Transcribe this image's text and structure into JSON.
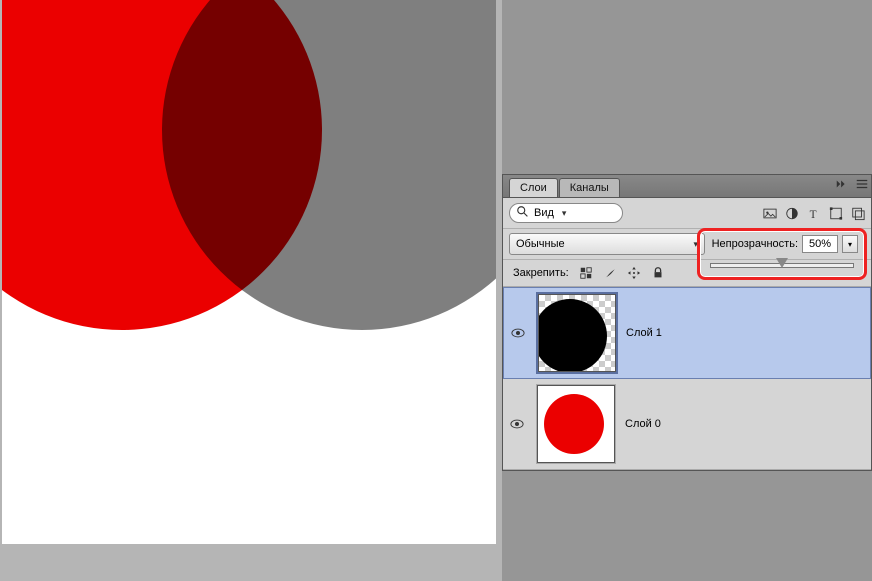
{
  "panel": {
    "tabs": {
      "layers": "Слои",
      "channels": "Каналы"
    },
    "search": {
      "icon": "magnify",
      "label": "Вид"
    },
    "filters": [
      "image",
      "fx",
      "text",
      "shape",
      "smart"
    ],
    "blend_mode": "Обычные",
    "opacity": {
      "label": "Непрозрачность:",
      "value": "50%"
    },
    "lock": {
      "label": "Закрепить:",
      "icons": [
        "pixels",
        "brush",
        "move",
        "lock"
      ]
    }
  },
  "layers": [
    {
      "name": "Слой 1",
      "selected": true,
      "fill": "#000000",
      "transparent_bg": true
    },
    {
      "name": "Слой 0",
      "selected": false,
      "fill": "#eb0000",
      "transparent_bg": false
    }
  ]
}
